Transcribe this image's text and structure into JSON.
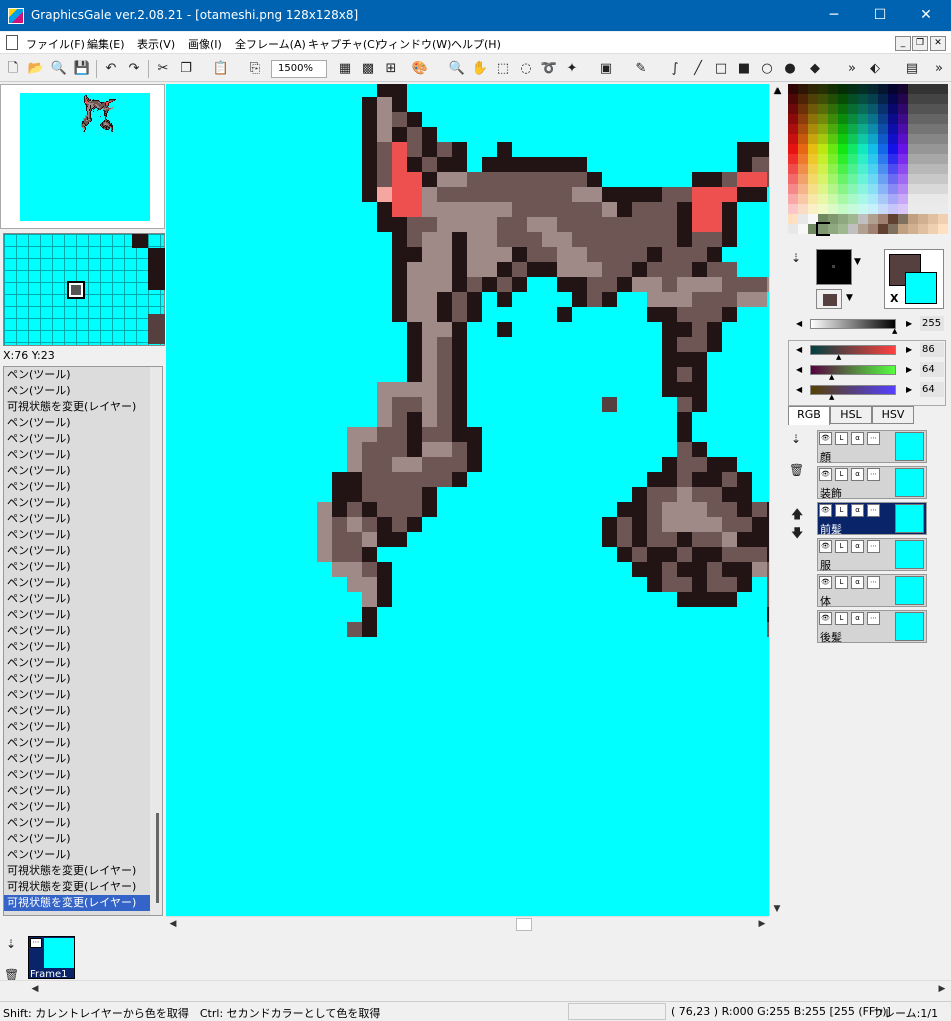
{
  "window": {
    "title": "GraphicsGale ver.2.08.21 - [otameshi.png 128x128x8]",
    "minimize": "─",
    "maximize": "☐",
    "close": "✕"
  },
  "menu": {
    "items": [
      "ファイル(F)",
      "編集(E)",
      "表示(V)",
      "画像(I)",
      "全フレーム(A)",
      "キャプチャ(C)",
      "ウィンドウ(W)",
      "ヘルプ(H)"
    ],
    "mdi_min": "_",
    "mdi_restore": "❐",
    "mdi_close": "✕"
  },
  "toolbar": {
    "zoom": "1500%"
  },
  "navigator": {
    "coords": "X:76 Y:23"
  },
  "history": {
    "items": [
      "ペン(ツール)",
      "ペン(ツール)",
      "可視状態を変更(レイヤー)",
      "ペン(ツール)",
      "ペン(ツール)",
      "ペン(ツール)",
      "ペン(ツール)",
      "ペン(ツール)",
      "ペン(ツール)",
      "ペン(ツール)",
      "ペン(ツール)",
      "ペン(ツール)",
      "ペン(ツール)",
      "ペン(ツール)",
      "ペン(ツール)",
      "ペン(ツール)",
      "ペン(ツール)",
      "ペン(ツール)",
      "ペン(ツール)",
      "ペン(ツール)",
      "ペン(ツール)",
      "ペン(ツール)",
      "ペン(ツール)",
      "ペン(ツール)",
      "ペン(ツール)",
      "ペン(ツール)",
      "ペン(ツール)",
      "ペン(ツール)",
      "ペン(ツール)",
      "ペン(ツール)",
      "ペン(ツール)",
      "可視状態を変更(レイヤー)",
      "可視状態を変更(レイヤー)",
      "可視状態を変更(レイヤー)"
    ],
    "selected_index": 33
  },
  "colors": {
    "background": "#00ffff",
    "foreground": "#55403f",
    "primary": "#000000",
    "x_label": "X"
  },
  "sliders": {
    "gray": "255",
    "r": "86",
    "g": "64",
    "b": "64"
  },
  "color_tabs": [
    "RGB",
    "HSL",
    "HSV"
  ],
  "layers": [
    {
      "name": "顔",
      "selected": false
    },
    {
      "name": "装飾",
      "selected": false
    },
    {
      "name": "前髪",
      "selected": true
    },
    {
      "name": "服",
      "selected": false
    },
    {
      "name": "体",
      "selected": false
    },
    {
      "name": "後髪",
      "selected": false
    }
  ],
  "frames": [
    {
      "label": "Frame1"
    }
  ],
  "status": {
    "hint": "Shift: カレントレイヤーから色を取得　Ctrl: セカンドカラーとして色を取得",
    "pixel": "( 76,23 ) R:000 G:255 B:255  [255 (FFh)]",
    "frame": "フレーム:1/1"
  }
}
